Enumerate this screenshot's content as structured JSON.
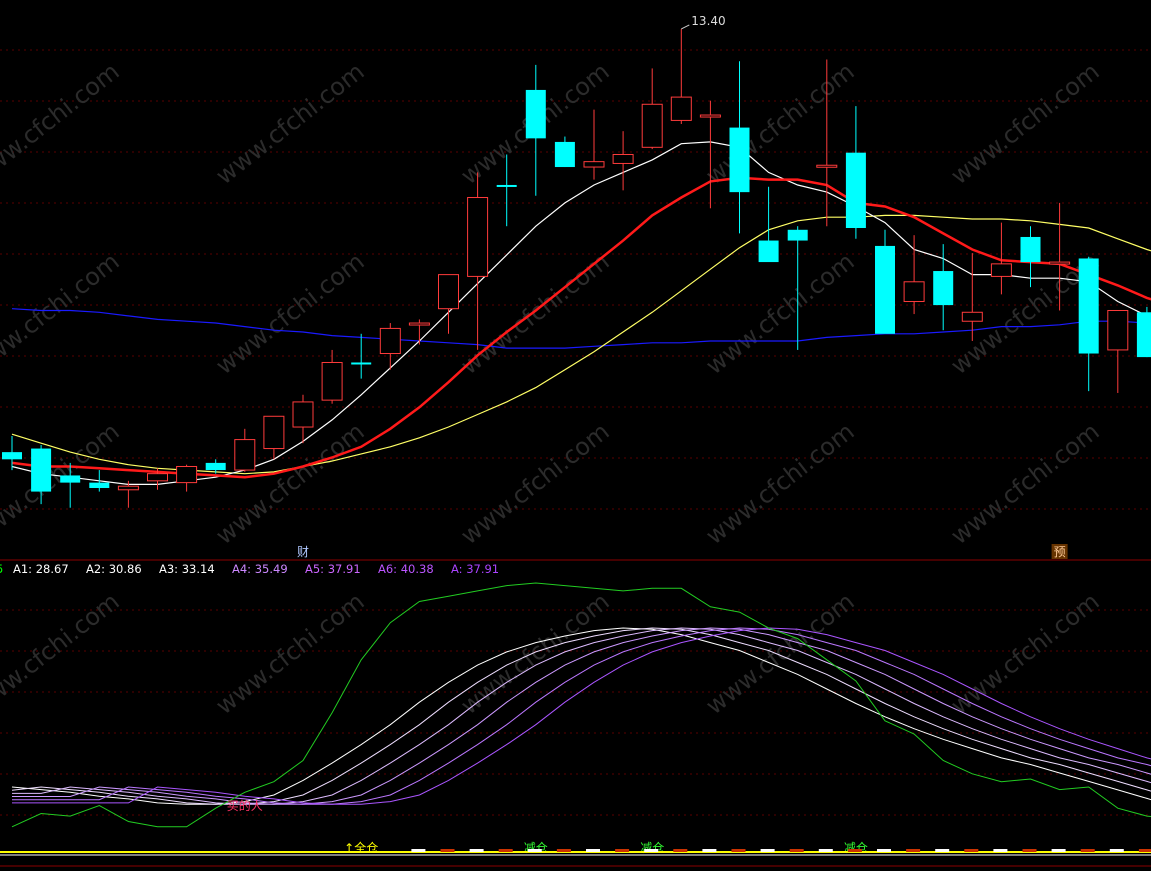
{
  "chart_data": [
    {
      "type": "candlestick",
      "title": "",
      "price_label": "13.40",
      "colors": {
        "up": "#ff3b3b",
        "down": "#00ffff",
        "ma_white": "#ffffff",
        "ma_red": "#ff1a1a",
        "ma_yellow": "#ffff66",
        "ma_blue": "#1a1aff"
      },
      "candles": [
        {
          "o": 11.04,
          "h": 11.13,
          "l": 10.94,
          "c": 11.0
        },
        {
          "o": 11.06,
          "h": 11.08,
          "l": 10.75,
          "c": 10.82
        },
        {
          "o": 10.91,
          "h": 10.98,
          "l": 10.73,
          "c": 10.87
        },
        {
          "o": 10.87,
          "h": 10.94,
          "l": 10.82,
          "c": 10.84
        },
        {
          "o": 10.83,
          "h": 10.88,
          "l": 10.73,
          "c": 10.85
        },
        {
          "o": 10.88,
          "h": 10.95,
          "l": 10.83,
          "c": 10.92
        },
        {
          "o": 10.87,
          "h": 10.97,
          "l": 10.82,
          "c": 10.96
        },
        {
          "o": 10.98,
          "h": 11.0,
          "l": 10.92,
          "c": 10.94
        },
        {
          "o": 10.94,
          "h": 11.17,
          "l": 10.93,
          "c": 11.11
        },
        {
          "o": 11.06,
          "h": 11.2,
          "l": 11.0,
          "c": 11.24
        },
        {
          "o": 11.18,
          "h": 11.36,
          "l": 11.09,
          "c": 11.32
        },
        {
          "o": 11.33,
          "h": 11.61,
          "l": 11.31,
          "c": 11.54
        },
        {
          "o": 11.54,
          "h": 11.7,
          "l": 11.45,
          "c": 11.53
        },
        {
          "o": 11.59,
          "h": 11.76,
          "l": 11.5,
          "c": 11.73
        },
        {
          "o": 11.76,
          "h": 11.78,
          "l": 11.64,
          "c": 11.76
        },
        {
          "o": 11.84,
          "h": 12.0,
          "l": 11.7,
          "c": 12.03
        },
        {
          "o": 12.02,
          "h": 12.6,
          "l": 11.61,
          "c": 12.46
        },
        {
          "o": 12.53,
          "h": 12.7,
          "l": 12.3,
          "c": 12.52
        },
        {
          "o": 13.06,
          "h": 13.2,
          "l": 12.47,
          "c": 12.79
        },
        {
          "o": 12.77,
          "h": 12.8,
          "l": 12.63,
          "c": 12.63
        },
        {
          "o": 12.63,
          "h": 12.95,
          "l": 12.56,
          "c": 12.66
        },
        {
          "o": 12.65,
          "h": 12.83,
          "l": 12.5,
          "c": 12.7
        },
        {
          "o": 12.74,
          "h": 13.18,
          "l": 12.73,
          "c": 12.98
        },
        {
          "o": 12.89,
          "h": 13.4,
          "l": 12.87,
          "c": 13.02
        },
        {
          "o": 12.92,
          "h": 13.0,
          "l": 12.4,
          "c": 12.92
        },
        {
          "o": 12.85,
          "h": 13.22,
          "l": 12.26,
          "c": 12.49
        },
        {
          "o": 12.22,
          "h": 12.52,
          "l": 12.13,
          "c": 12.1
        },
        {
          "o": 12.28,
          "h": 12.3,
          "l": 11.61,
          "c": 12.22
        },
        {
          "o": 12.64,
          "h": 13.23,
          "l": 12.3,
          "c": 12.64
        },
        {
          "o": 12.71,
          "h": 12.97,
          "l": 12.23,
          "c": 12.29
        },
        {
          "o": 12.19,
          "h": 12.28,
          "l": 11.71,
          "c": 11.7
        },
        {
          "o": 11.88,
          "h": 12.25,
          "l": 11.81,
          "c": 11.99
        },
        {
          "o": 12.05,
          "h": 12.2,
          "l": 11.72,
          "c": 11.86
        },
        {
          "o": 11.77,
          "h": 12.15,
          "l": 11.66,
          "c": 11.82
        },
        {
          "o": 12.02,
          "h": 12.32,
          "l": 11.92,
          "c": 12.09
        },
        {
          "o": 12.24,
          "h": 12.3,
          "l": 11.96,
          "c": 12.1
        },
        {
          "o": 12.1,
          "h": 12.43,
          "l": 11.83,
          "c": 12.1
        },
        {
          "o": 12.12,
          "h": 12.13,
          "l": 11.38,
          "c": 11.59
        },
        {
          "o": 11.61,
          "h": 11.78,
          "l": 11.37,
          "c": 11.83
        },
        {
          "o": 11.82,
          "h": 11.85,
          "l": 11.57,
          "c": 11.57
        },
        {
          "o": 11.47,
          "h": 11.57,
          "l": 11.4,
          "c": 11.47
        },
        {
          "o": 11.61,
          "h": 11.68,
          "l": 11.43,
          "c": 11.73
        }
      ],
      "ma_white": [
        10.96,
        10.92,
        10.9,
        10.88,
        10.86,
        10.86,
        10.88,
        10.9,
        10.94,
        11.0,
        11.1,
        11.22,
        11.36,
        11.51,
        11.66,
        11.82,
        11.98,
        12.14,
        12.3,
        12.43,
        12.53,
        12.6,
        12.67,
        12.76,
        12.77,
        12.74,
        12.6,
        12.53,
        12.49,
        12.41,
        12.32,
        12.17,
        12.12,
        12.03,
        12.03,
        12.01,
        12.01,
        11.99,
        11.88,
        11.8,
        11.72,
        11.7
      ],
      "ma_red": [
        10.98,
        10.96,
        10.96,
        10.95,
        10.94,
        10.93,
        10.92,
        10.91,
        10.9,
        10.92,
        10.96,
        11.01,
        11.07,
        11.17,
        11.29,
        11.43,
        11.58,
        11.71,
        11.83,
        11.96,
        12.09,
        12.22,
        12.36,
        12.46,
        12.55,
        12.57,
        12.56,
        12.56,
        12.53,
        12.43,
        12.41,
        12.35,
        12.26,
        12.17,
        12.11,
        12.1,
        12.09,
        12.03,
        11.97,
        11.9,
        11.85,
        11.82
      ],
      "ma_yellow": [
        11.14,
        11.09,
        11.04,
        11.0,
        10.97,
        10.95,
        10.94,
        10.93,
        10.92,
        10.93,
        10.96,
        10.99,
        11.03,
        11.07,
        11.12,
        11.18,
        11.25,
        11.32,
        11.4,
        11.5,
        11.6,
        11.71,
        11.82,
        11.94,
        12.06,
        12.18,
        12.28,
        12.33,
        12.35,
        12.35,
        12.36,
        12.36,
        12.35,
        12.34,
        12.34,
        12.33,
        12.31,
        12.29,
        12.23,
        12.17,
        12.12,
        12.08
      ],
      "ma_blue": [
        11.84,
        11.83,
        11.83,
        11.82,
        11.8,
        11.78,
        11.77,
        11.76,
        11.74,
        11.72,
        11.71,
        11.69,
        11.68,
        11.67,
        11.66,
        11.65,
        11.64,
        11.62,
        11.62,
        11.62,
        11.63,
        11.64,
        11.65,
        11.65,
        11.66,
        11.66,
        11.66,
        11.66,
        11.68,
        11.69,
        11.7,
        11.7,
        11.71,
        11.72,
        11.74,
        11.74,
        11.75,
        11.77,
        11.77,
        11.76,
        11.75,
        11.74
      ],
      "ylim": [
        10.55,
        13.45
      ],
      "markers": [
        {
          "index": 10,
          "text": "财",
          "color": "#b0c8ff"
        },
        {
          "index": 36,
          "text": "预",
          "color": "#ffcc99",
          "bg": "#663300"
        }
      ]
    },
    {
      "type": "line",
      "title": "",
      "legend": [
        {
          "name": "5",
          "value": "",
          "color": "#00ff00"
        },
        {
          "name": "A1:",
          "value": "28.67",
          "color": "#ffffff"
        },
        {
          "name": "A2:",
          "value": "30.86",
          "color": "#ffffff"
        },
        {
          "name": "A3:",
          "value": "33.14",
          "color": "#ffffff"
        },
        {
          "name": "A4:",
          "value": "35.49",
          "color": "#cc88ff"
        },
        {
          "name": "A5:",
          "value": "37.91",
          "color": "#cc66ff"
        },
        {
          "name": "A6:",
          "value": "40.38",
          "color": "#bb55ff"
        },
        {
          "name": "A:",
          "value": "37.91",
          "color": "#aa44ff"
        }
      ],
      "ylim": [
        0,
        100
      ],
      "green_line": [
        5,
        10,
        9,
        13,
        7,
        5,
        5,
        12,
        18,
        22,
        30,
        48,
        68,
        82,
        90,
        92,
        94,
        96,
        97,
        96,
        95,
        94,
        95,
        95,
        88,
        86,
        80,
        76,
        68,
        60,
        45,
        40,
        30,
        25,
        22,
        23,
        19,
        20,
        12,
        9,
        8,
        8
      ],
      "ribbon_base": [
        20,
        19,
        18,
        16.5,
        15.5,
        14,
        13.5,
        13.5,
        14.5,
        17,
        22.5,
        29,
        36,
        43.5,
        52,
        59.5,
        66,
        71,
        74.5,
        77,
        79,
        80,
        79.5,
        77.5,
        74.5,
        71.5,
        67,
        62.5,
        57,
        51.5,
        46.5,
        42,
        38,
        34.5,
        31,
        28.5
      ],
      "annotations": [
        {
          "text": "买的人",
          "color": "#ff3366",
          "index": 8
        },
        {
          "text": "↑全仓",
          "color": "#ffff00",
          "index": 12
        },
        {
          "text": "减仓",
          "color": "#33ff33",
          "index": 18
        },
        {
          "text": "减仓",
          "color": "#33ff33",
          "index": 22
        },
        {
          "text": "减仓",
          "color": "#33ff33",
          "index": 29
        }
      ]
    }
  ],
  "watermark": "www.cfchi.com"
}
